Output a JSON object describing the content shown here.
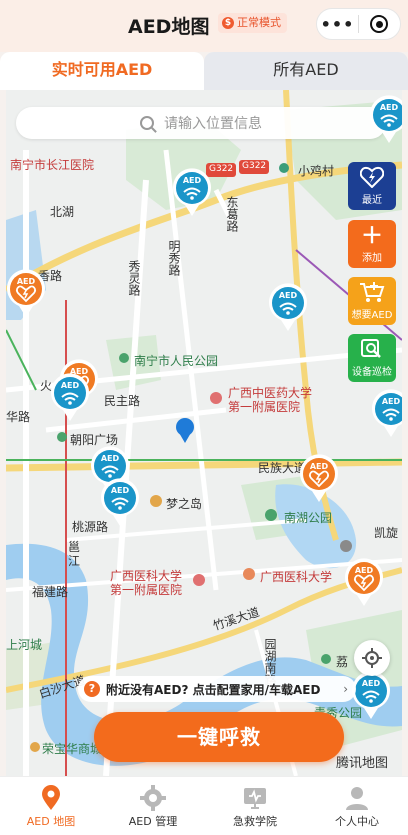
{
  "header": {
    "title": "AED地图",
    "mode_label": "正常模式",
    "mode_icon": "$",
    "menu_dots": "•••"
  },
  "tabs": [
    {
      "label": "实时可用AED",
      "active": true
    },
    {
      "label": "所有AED",
      "active": false
    }
  ],
  "search": {
    "placeholder": "请输入位置信息"
  },
  "map": {
    "labels": {
      "hospital_changjiang": "南宁市长江医院",
      "xiaojicun": "小鸡村",
      "beihu": "北湖",
      "dongge_road": "东葛路",
      "mingxiu_road": "明秀路",
      "xiuling_road": "秀灵路",
      "xiangzhu_road": "香",
      "lu": "路",
      "nanning_people_park": "南宁市人民公园",
      "tcm_hospital": "广西中医药大学\n第一附属医院",
      "minzhu_road": "民主路",
      "zhaoyang_plaza": "朝阳广场",
      "huo": "火",
      "hua_road": "华路",
      "minzu_ave": "民族大道",
      "dream_island": "梦之岛",
      "nanhu_park": "南湖公园",
      "kaixuan": "凯旋",
      "taoyuan_road": "桃源路",
      "yong_jiang": "邕\n江",
      "fujian_road": "福建路",
      "gxmu_hospital": "广西医科大学\n第一附属医院",
      "gxmu": "广西医科大学",
      "zhuxi_ave": "竹溪大道",
      "shanghe_city": "上河城",
      "baisha_ave": "白沙大道",
      "yuandong_road": "园湖南路",
      "li": "荔",
      "qingxiu_park": "青秀公园",
      "rongbao": "荣宝华商城",
      "tencent_map": "腾讯地图",
      "g322_a": "G322",
      "g322_b": "G322"
    }
  },
  "side_buttons": [
    {
      "label": "最近",
      "icon": "heart-bolt-icon",
      "color": "#1c3f93"
    },
    {
      "label": "添加",
      "icon": "plus-icon",
      "color": "#f36b1c"
    },
    {
      "label": "想要AED",
      "icon": "cart-icon",
      "color": "#f5a21a"
    },
    {
      "label": "设备巡检",
      "icon": "inspect-icon",
      "color": "#27b14b"
    }
  ],
  "notice": {
    "text": "附近没有AED? 点击配置家用/车载AED",
    "arrow": "›"
  },
  "rescue_button": "一键呼救",
  "nav": [
    {
      "label": "AED 地图",
      "icon": "map-pin-icon",
      "active": true
    },
    {
      "label": "AED 管理",
      "icon": "gear-icon",
      "active": false
    },
    {
      "label": "急救学院",
      "icon": "academy-icon",
      "active": false
    },
    {
      "label": "个人中心",
      "icon": "person-icon",
      "active": false
    }
  ],
  "colors": {
    "accent": "#f36b1c",
    "aed_blue": "#1a95c9",
    "aed_orange": "#f07a23"
  },
  "aed_label": "AED"
}
